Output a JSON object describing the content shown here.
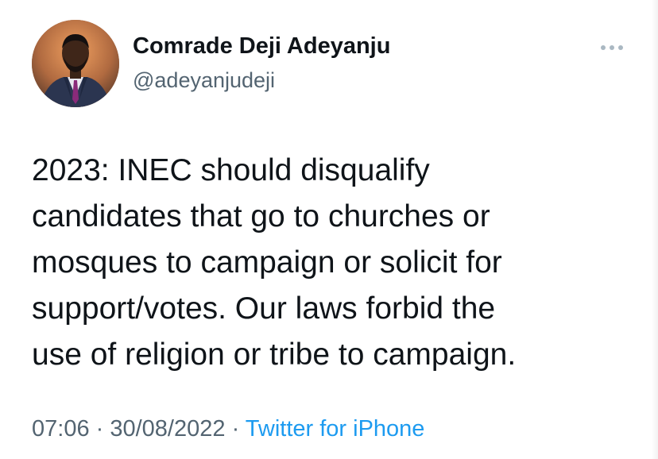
{
  "author": {
    "display_name": "Comrade Deji Adeyanju",
    "handle": "@adeyanjudeji"
  },
  "tweet": {
    "text": "2023: INEC should disqualify\ncandidates that go to churches or\nmosques to campaign or solicit for\nsupport/votes. Our laws forbid the\nuse of religion or tribe to campaign."
  },
  "meta": {
    "time": "07:06",
    "separator1": " · ",
    "date": "30/08/2022",
    "separator2": " · ",
    "source": "Twitter for iPhone"
  },
  "icons": {
    "more": "more-horizontal-icon",
    "avatar": "profile-photo"
  },
  "colors": {
    "text_primary": "#0f1419",
    "text_secondary": "#536471",
    "link": "#1d9bf0",
    "more_icon": "#aab8c2"
  }
}
